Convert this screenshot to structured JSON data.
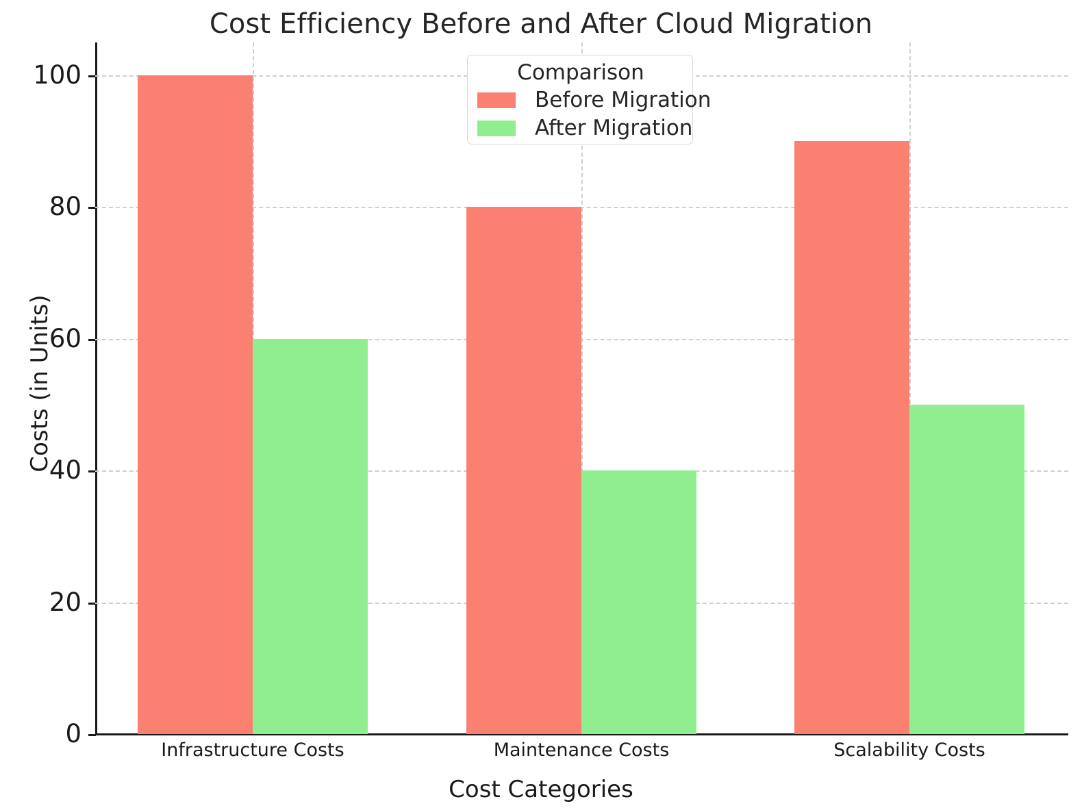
{
  "chart_data": {
    "type": "bar",
    "title": "Cost Efficiency Before and After Cloud Migration",
    "xlabel": "Cost Categories",
    "ylabel": "Costs (in Units)",
    "categories": [
      "Infrastructure Costs",
      "Maintenance Costs",
      "Scalability Costs"
    ],
    "series": [
      {
        "name": "Before Migration",
        "color": "#fa8072",
        "values": [
          100,
          80,
          90
        ]
      },
      {
        "name": "After Migration",
        "color": "#90ee90",
        "values": [
          60,
          40,
          50
        ]
      }
    ],
    "ylim": [
      0,
      105
    ],
    "yticks": [
      0,
      20,
      40,
      60,
      80,
      100
    ],
    "ytick_labels": [
      "0",
      "20",
      "40",
      "60",
      "80",
      "100"
    ],
    "grid": "dashed-both-axes",
    "legend": {
      "title": "Comparison",
      "position": "upper-center",
      "entries": [
        {
          "label": "Before Migration",
          "color": "#fa8072"
        },
        {
          "label": "After Migration",
          "color": "#90ee90"
        }
      ]
    },
    "colors": {
      "before_migration": "#fa8072",
      "after_migration": "#90ee90",
      "grid": "#cfcfcf",
      "axis": "#1a1a1a",
      "text": "#262626",
      "background": "#ffffff"
    }
  }
}
